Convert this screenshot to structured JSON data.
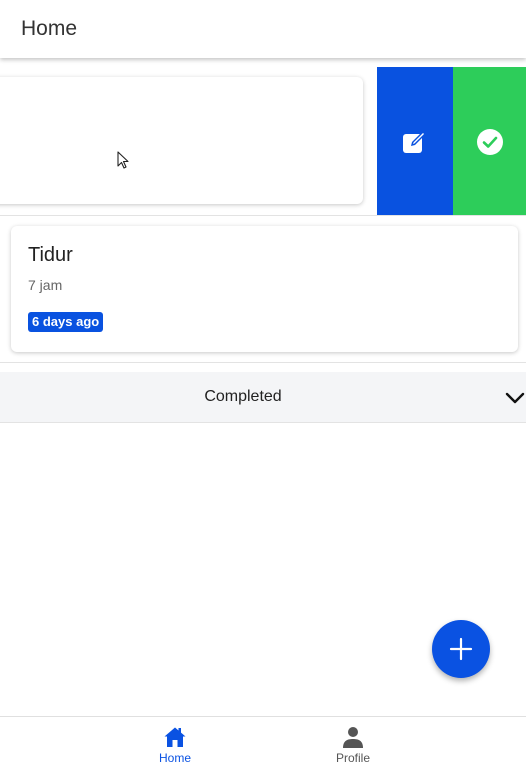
{
  "header": {
    "title": "Home"
  },
  "swiped_item": {
    "actions": [
      {
        "name": "edit",
        "icon": "edit-icon",
        "color": "#0952e0"
      },
      {
        "name": "complete",
        "icon": "check-circle-icon",
        "color": "#2dcd5a"
      }
    ]
  },
  "task": {
    "title": "Tidur",
    "subtitle": "7 jam",
    "badge": "6 days ago"
  },
  "completed_section": {
    "label": "Completed",
    "icon": "chevron-down-icon"
  },
  "fab": {
    "icon": "plus-icon"
  },
  "bottom_nav": {
    "items": [
      {
        "label": "Home",
        "icon": "home-icon",
        "active": true
      },
      {
        "label": "Profile",
        "icon": "person-icon",
        "active": false
      }
    ]
  },
  "colors": {
    "primary": "#0a52e2",
    "success": "#2dcd5a",
    "accordion_bg": "#f4f5f7"
  }
}
